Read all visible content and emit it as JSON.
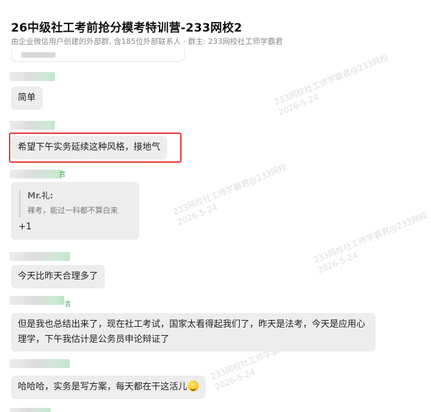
{
  "header": {
    "title": "26中级社工考前抢分模考特训营-233网校2",
    "subtitle": "由企业微信用户创建的外部群, 含185位外部联系人 · 群主: 233网校社工师学霸君"
  },
  "watermark": {
    "line1": "233网校社工师学霸君@233网校",
    "line2": "2026-5-24"
  },
  "messages": [
    {
      "type": "text",
      "text": "简单"
    },
    {
      "type": "text",
      "text": "希望下午实务延续这种风格，接地气",
      "highlighted": true
    },
    {
      "type": "quote",
      "sender_tag": "言",
      "quote_name": "Mr.礼:",
      "quote_text": "裸考，能过一科都不算白来",
      "reply": "+1"
    },
    {
      "type": "text",
      "text": "今天比昨天合理多了"
    },
    {
      "type": "text",
      "sender_tag": "言",
      "text_line1": "但是我也总结出来了，现在社工考试，国家太看得起我们了，昨天是法考，今天是应用心",
      "text_line2": "理学，下午我估计是公务员申论辩证了"
    },
    {
      "type": "text",
      "text": "哈哈哈，实务是写方案，每天都在干这活儿",
      "emoji": "smirk-emoji"
    }
  ]
}
